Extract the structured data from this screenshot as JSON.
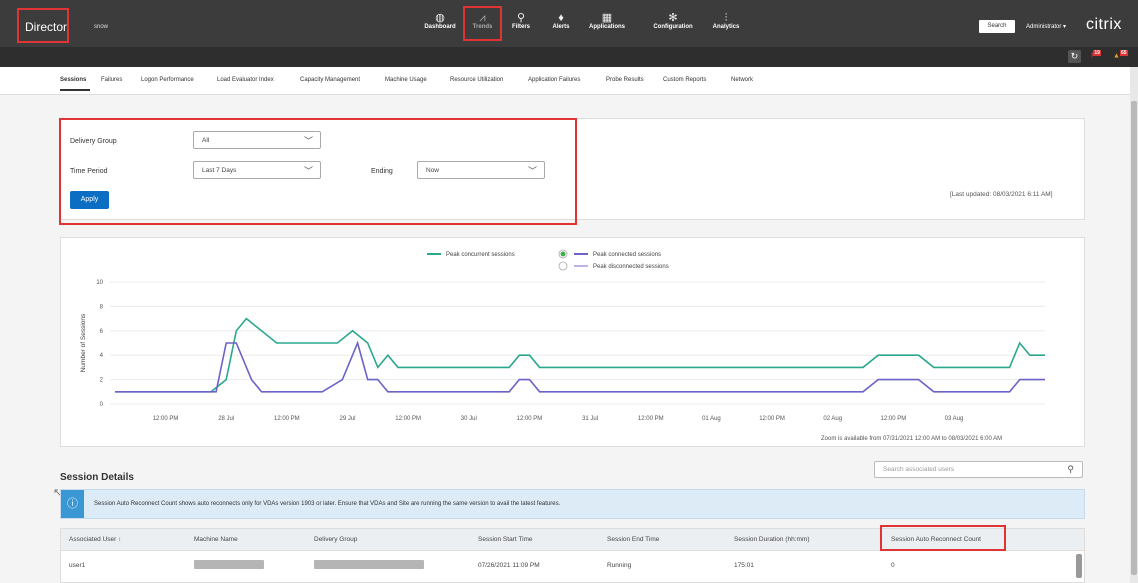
{
  "app": {
    "name": "Director",
    "site": "snow"
  },
  "nav": [
    {
      "label": "Dashboard",
      "icon": "dashboard-icon"
    },
    {
      "label": "Trends",
      "icon": "trends-icon"
    },
    {
      "label": "Filters",
      "icon": "filters-icon"
    },
    {
      "label": "Alerts",
      "icon": "bell-icon"
    },
    {
      "label": "Applications",
      "icon": "grid-icon"
    },
    {
      "label": "Configuration",
      "icon": "gear-icon"
    },
    {
      "label": "Analytics",
      "icon": "analytics-icon"
    }
  ],
  "header": {
    "search_label": "Search",
    "admin_label": "Administrator ▾",
    "brand": "citrix",
    "alert_red": "19",
    "alert_orange": "65"
  },
  "tabs": [
    "Sessions",
    "Failures",
    "Logon Performance",
    "Load Evaluator Index",
    "Capacity Management",
    "Machine Usage",
    "Resource Utilization",
    "Application Failures",
    "Probe Results",
    "Custom Reports",
    "Network"
  ],
  "filters": {
    "delivery_group_label": "Delivery Group",
    "delivery_group_value": "All",
    "time_period_label": "Time Period",
    "time_period_value": "Last 7 Days",
    "ending_label": "Ending",
    "ending_value": "Now",
    "apply_label": "Apply",
    "last_updated": "[Last updated: 08/03/2021 6:11 AM]"
  },
  "chart_data": {
    "type": "line",
    "ylabel": "Number of Sessions",
    "ylim": [
      0,
      10
    ],
    "yticks": [
      0,
      2,
      4,
      6,
      8,
      10
    ],
    "xtick_labels": [
      "12:00 PM",
      "28 Jul",
      "12:00 PM",
      "29 Jul",
      "12:00 PM",
      "30 Jul",
      "12:00 PM",
      "31 Jul",
      "12:00 PM",
      "01 Aug",
      "12:00 PM",
      "02 Aug",
      "12:00 PM",
      "03 Aug"
    ],
    "x_hours_from_start": [
      0,
      12,
      24,
      36,
      48,
      60,
      72,
      84,
      96,
      108,
      120,
      132,
      144,
      156
    ],
    "legend": [
      "Peak concurrent sessions",
      "Peak connected sessions",
      "Peak disconnected sessions"
    ],
    "legend_colors": [
      "#2aa88e",
      "#6b63c7",
      "#b9b5e8"
    ],
    "series": [
      {
        "name": "Peak concurrent sessions",
        "color": "#2aa88e",
        "points": [
          [
            -10,
            1
          ],
          [
            9,
            1
          ],
          [
            12,
            2
          ],
          [
            14,
            6
          ],
          [
            16,
            7
          ],
          [
            22,
            5
          ],
          [
            34,
            5
          ],
          [
            37,
            6
          ],
          [
            40,
            5
          ],
          [
            42,
            3
          ],
          [
            44,
            4
          ],
          [
            46,
            3
          ],
          [
            68,
            3
          ],
          [
            70,
            4
          ],
          [
            72,
            4
          ],
          [
            74,
            3
          ],
          [
            138,
            3
          ],
          [
            141,
            4
          ],
          [
            149,
            4
          ],
          [
            152,
            3
          ],
          [
            167,
            3
          ],
          [
            169,
            5
          ],
          [
            171,
            4
          ],
          [
            174,
            4
          ]
        ]
      },
      {
        "name": "Peak connected sessions",
        "color": "#6b63c7",
        "points": [
          [
            -10,
            1
          ],
          [
            10,
            1
          ],
          [
            12,
            5
          ],
          [
            14,
            5
          ],
          [
            17,
            2
          ],
          [
            19,
            1
          ],
          [
            31,
            1
          ],
          [
            35,
            2
          ],
          [
            38,
            5
          ],
          [
            40,
            2
          ],
          [
            42,
            2
          ],
          [
            44,
            1
          ],
          [
            68,
            1
          ],
          [
            70,
            2
          ],
          [
            72,
            2
          ],
          [
            74,
            1
          ],
          [
            138,
            1
          ],
          [
            141,
            2
          ],
          [
            149,
            2
          ],
          [
            152,
            1
          ],
          [
            167,
            1
          ],
          [
            169,
            2
          ],
          [
            174,
            2
          ]
        ]
      }
    ],
    "zoom_note": "Zoom is available from 07/31/2021 12:00 AM to 08/03/2021 6:00 AM"
  },
  "session_details": {
    "title": "Session Details",
    "search_placeholder": "Search associated users",
    "info_text": "Session Auto Reconnect Count shows auto reconnects only for VDAs version 1903 or later. Ensure that VDAs and Site are running the same version to avail the latest features.",
    "columns": [
      "Associated User ↑",
      "Machine Name",
      "Delivery Group",
      "Session Start Time",
      "Session End Time",
      "Session Duration (hh:mm)",
      "Session Auto Reconnect Count"
    ],
    "rows": [
      {
        "user": "user1",
        "start": "07/26/2021 11:09 PM",
        "end": "Running",
        "duration": "175:01",
        "reconnect": "0"
      }
    ]
  }
}
